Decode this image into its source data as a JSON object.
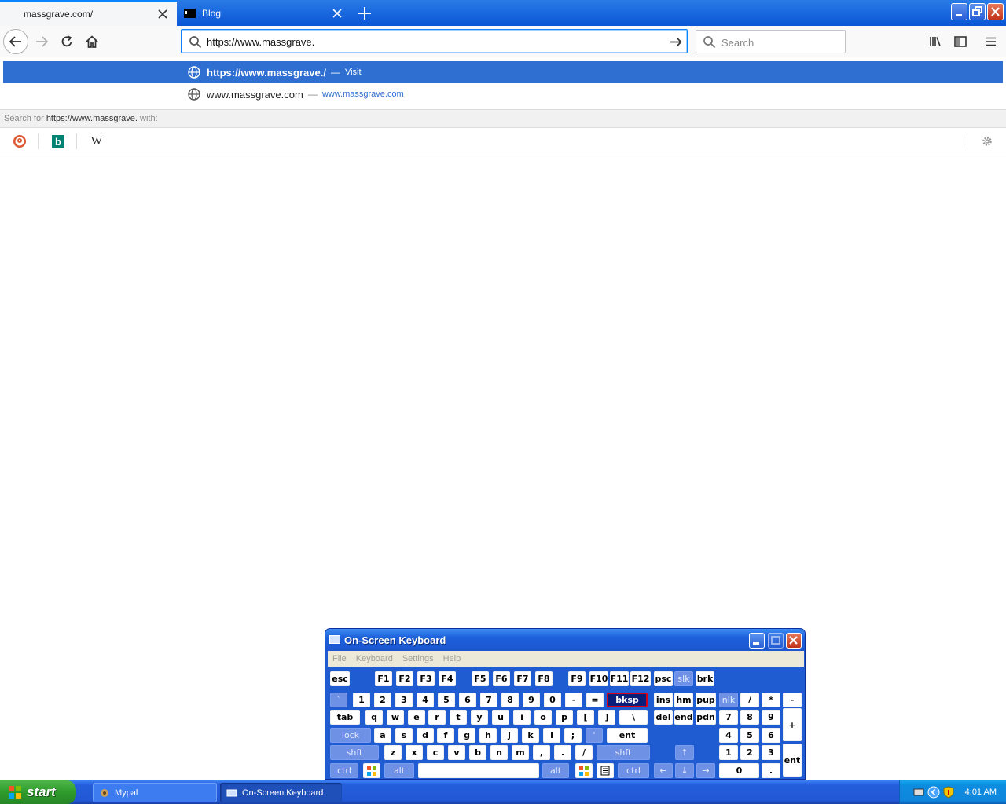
{
  "browser": {
    "tabs": [
      {
        "title": "massgrave.com/",
        "active": true
      },
      {
        "title": "Blog",
        "active": false
      }
    ],
    "url_value": "https://www.massgrave.",
    "search_placeholder": "Search",
    "autocomplete": [
      {
        "text": "https://www.massgrave./",
        "separator": "—",
        "action": "Visit",
        "selected": true
      },
      {
        "text": "www.massgrave.com",
        "separator": "—",
        "action": "www.massgrave.com",
        "selected": false
      }
    ],
    "search_for_prefix": "Search for",
    "search_for_query": "https://www.massgrave.",
    "search_for_suffix": "with:",
    "engines": [
      "duckduckgo-icon",
      "bing-icon",
      "wikipedia-icon"
    ],
    "wikipedia_glyph": "W",
    "bing_glyph": "b"
  },
  "osk": {
    "title": "On-Screen Keyboard",
    "menu": [
      "File",
      "Keyboard",
      "Settings",
      "Help"
    ],
    "rows": {
      "fn": [
        "esc",
        "F1",
        "F2",
        "F3",
        "F4",
        "F5",
        "F6",
        "F7",
        "F8",
        "F9",
        "F10",
        "F11",
        "F12",
        "psc",
        "slk",
        "brk"
      ],
      "num": [
        "`",
        "1",
        "2",
        "3",
        "4",
        "5",
        "6",
        "7",
        "8",
        "9",
        "0",
        "-",
        "=",
        "bksp",
        "ins",
        "hm",
        "pup",
        "nlk",
        "/",
        "*",
        "-"
      ],
      "q": [
        "tab",
        "q",
        "w",
        "e",
        "r",
        "t",
        "y",
        "u",
        "i",
        "o",
        "p",
        "[",
        "]",
        "\\",
        "del",
        "end",
        "pdn",
        "7",
        "8",
        "9",
        "+"
      ],
      "a": [
        "lock",
        "a",
        "s",
        "d",
        "f",
        "g",
        "h",
        "j",
        "k",
        "l",
        ";",
        "'",
        "ent",
        "4",
        "5",
        "6"
      ],
      "z": [
        "shft",
        "z",
        "x",
        "c",
        "v",
        "b",
        "n",
        "m",
        ",",
        ".",
        "/",
        "shft",
        "↑",
        "1",
        "2",
        "3",
        "ent"
      ],
      "bottom": [
        "ctrl",
        "win",
        "alt",
        "",
        "alt",
        "win",
        "menu",
        "ctrl",
        "←",
        "↓",
        "→",
        "0",
        "."
      ]
    },
    "highlighted_key": "bksp"
  },
  "taskbar": {
    "start_label": "start",
    "tasks": [
      {
        "label": "Mypal"
      },
      {
        "label": "On-Screen Keyboard"
      }
    ],
    "clock": "4:01 AM"
  }
}
